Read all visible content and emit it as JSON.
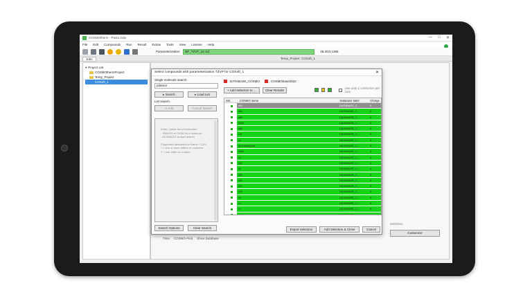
{
  "window": {
    "title": "COSMOtherm - Pasta Zolp",
    "controls": [
      "—",
      "□",
      "✕"
    ]
  },
  "menu": [
    "File",
    "Edit",
    "Compounds",
    "Run",
    "Result",
    "Extras",
    "Tools",
    "View",
    "License",
    "Help"
  ],
  "toolbar": {
    "param_label": "Parameterization:",
    "param_value": "BP_TZVP_22.ctd",
    "param_date": "28.4/23.1366"
  },
  "tabs": {
    "jobs": "Jobs",
    "project": "Temp_Project: COSoft_1"
  },
  "tree": [
    {
      "label": "Project List",
      "selected": false
    },
    {
      "label": "COSMOthermProject",
      "selected": false
    },
    {
      "label": "Temp_Project",
      "selected": false
    },
    {
      "label": "COSoft_1",
      "selected": true
    }
  ],
  "dialog": {
    "title": "Select compounds with parameterization TZVP for COSoft_1",
    "single_search_label": "Single molecule search",
    "search_value": "pdamar",
    "search_button": "Search",
    "load_list_button": "Load List",
    "list_search_label": "List search",
    "add_button": "Add",
    "cancel_search_button": "Cancel Search",
    "list_hint_lines": [
      "Enter / paste list of molecules:",
      "- SMILES or CAS# for a molecule",
      "- All SMILES to start search",
      "",
      "Supported wildcards for Name / CAS:",
      "* = one or more letters or numbers",
      "? = one letter or number"
    ],
    "search_options_button": "Search Options",
    "clear_search_button": "Clear Search",
    "db_checks": [
      "DATABASE_COSMO",
      "COSMObase2022"
    ],
    "add_selection_button": "Add Selection to ...",
    "clear_results_button": "Clear Results",
    "use_only_label": "Use only 1 conformer per com",
    "columns": [
      "Sel.",
      "COSMO name",
      "Database label",
      "Charge"
    ],
    "rows": [
      {
        "name": "r83",
        "db": "DATABASE_C...",
        "charge": "0"
      },
      {
        "name": "r84",
        "db": "DATABASE_C...",
        "charge": "0"
      },
      {
        "name": "r85",
        "db": "DATABASE_C...",
        "charge": "0"
      },
      {
        "name": "r86b",
        "db": "DATABASE_C...",
        "charge": "0"
      },
      {
        "name": "r88",
        "db": "DATABASE_C...",
        "charge": "0"
      },
      {
        "name": "r91",
        "db": "DATABASE_C...",
        "charge": "0"
      },
      {
        "name": "r4",
        "db": "DATABASE_C...",
        "charge": "0"
      },
      {
        "name": "aminoalkyloid",
        "db": "DATABASE_C...",
        "charge": "0"
      },
      {
        "name": "r88b",
        "db": "DATABASE_C...",
        "charge": "0"
      },
      {
        "name": "r3",
        "db": "DATABASE_C...",
        "charge": "0"
      },
      {
        "name": "r90",
        "db": "DATABASE_C...",
        "charge": "0"
      },
      {
        "name": "r5",
        "db": "DATABASE_C...",
        "charge": "0"
      },
      {
        "name": "r89",
        "db": "DATABASE_C...",
        "charge": "0"
      },
      {
        "name": "r92",
        "db": "DATABASE_C...",
        "charge": "0"
      },
      {
        "name": "r87",
        "db": "DATABASE_C...",
        "charge": "0"
      },
      {
        "name": "r93",
        "db": "DATABASE_C...",
        "charge": "0"
      },
      {
        "name": "r6",
        "db": "DATABASE_C...",
        "charge": "0"
      },
      {
        "name": "r2",
        "db": "DATABASE_C...",
        "charge": "0"
      },
      {
        "name": "r1",
        "db": "DATABASE_C...",
        "charge": "0"
      },
      {
        "name": "r94",
        "db": "DATABASE_C...",
        "charge": "0"
      }
    ],
    "export_button": "Export Selection",
    "add_close_button": "Add Selection & Close",
    "cancel_button": "Cancel"
  },
  "right": {
    "selection_label": "Selection",
    "customize_button": "Customize"
  },
  "below": {
    "options": [
      "Time",
      "COSMO-Find",
      "Show Database"
    ]
  },
  "colors": {
    "green_row": "#14d414",
    "param_green": "#7ed67a",
    "status_green": "#2ea84a"
  }
}
